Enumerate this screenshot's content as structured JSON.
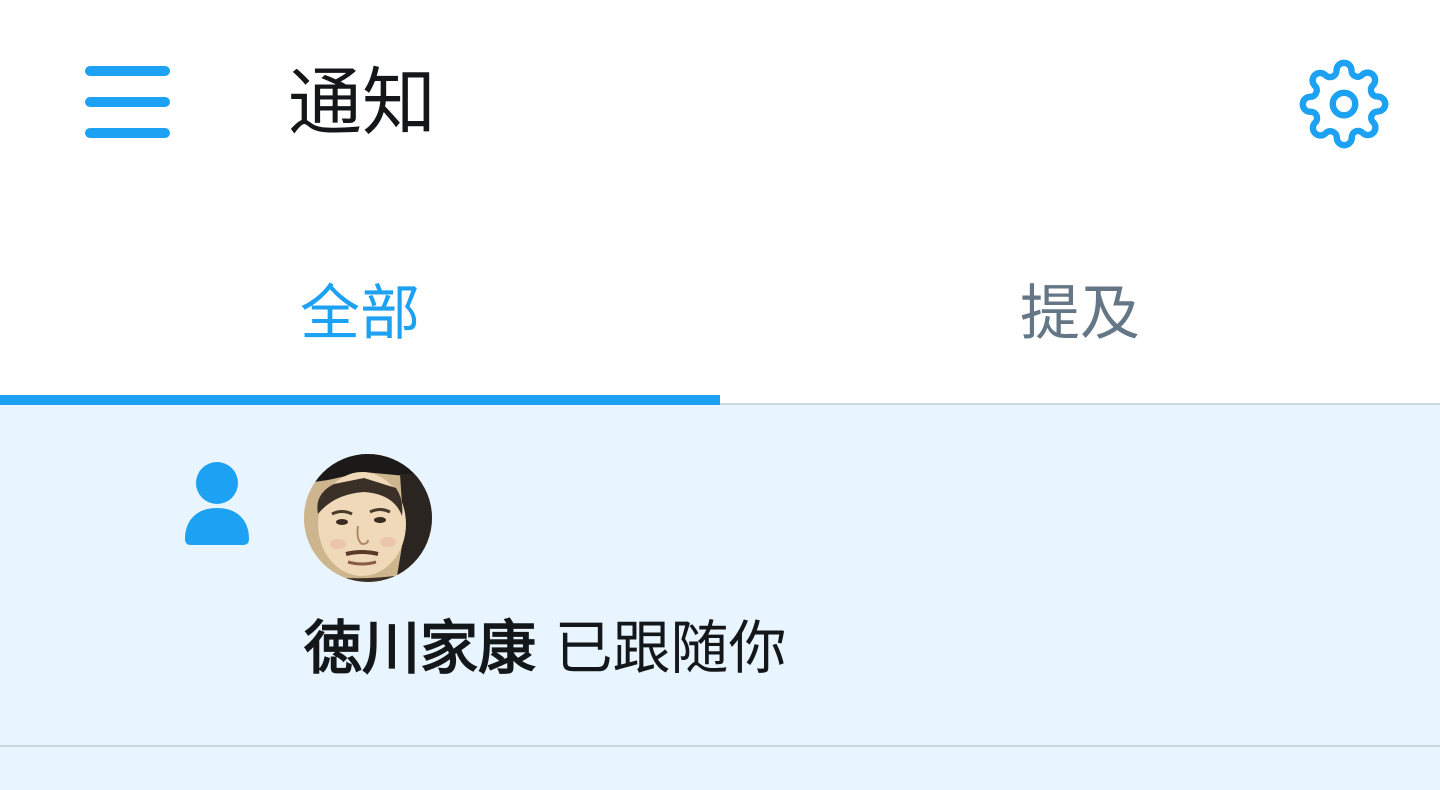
{
  "header": {
    "title": "通知",
    "menu_icon": "hamburger-menu-icon",
    "settings_icon": "gear-icon"
  },
  "tabs": [
    {
      "label": "全部",
      "active": true
    },
    {
      "label": "提及",
      "active": false
    }
  ],
  "notifications": [
    {
      "type_icon": "person-follow-icon",
      "user_name": "徳川家康",
      "action_text": "已跟随你",
      "avatar": "user-portrait"
    }
  ],
  "colors": {
    "accent": "#1da1f2",
    "unread_background": "#e8f5fe",
    "text_primary": "#14171a",
    "text_secondary": "#657786",
    "divider": "#ccd6dd"
  }
}
